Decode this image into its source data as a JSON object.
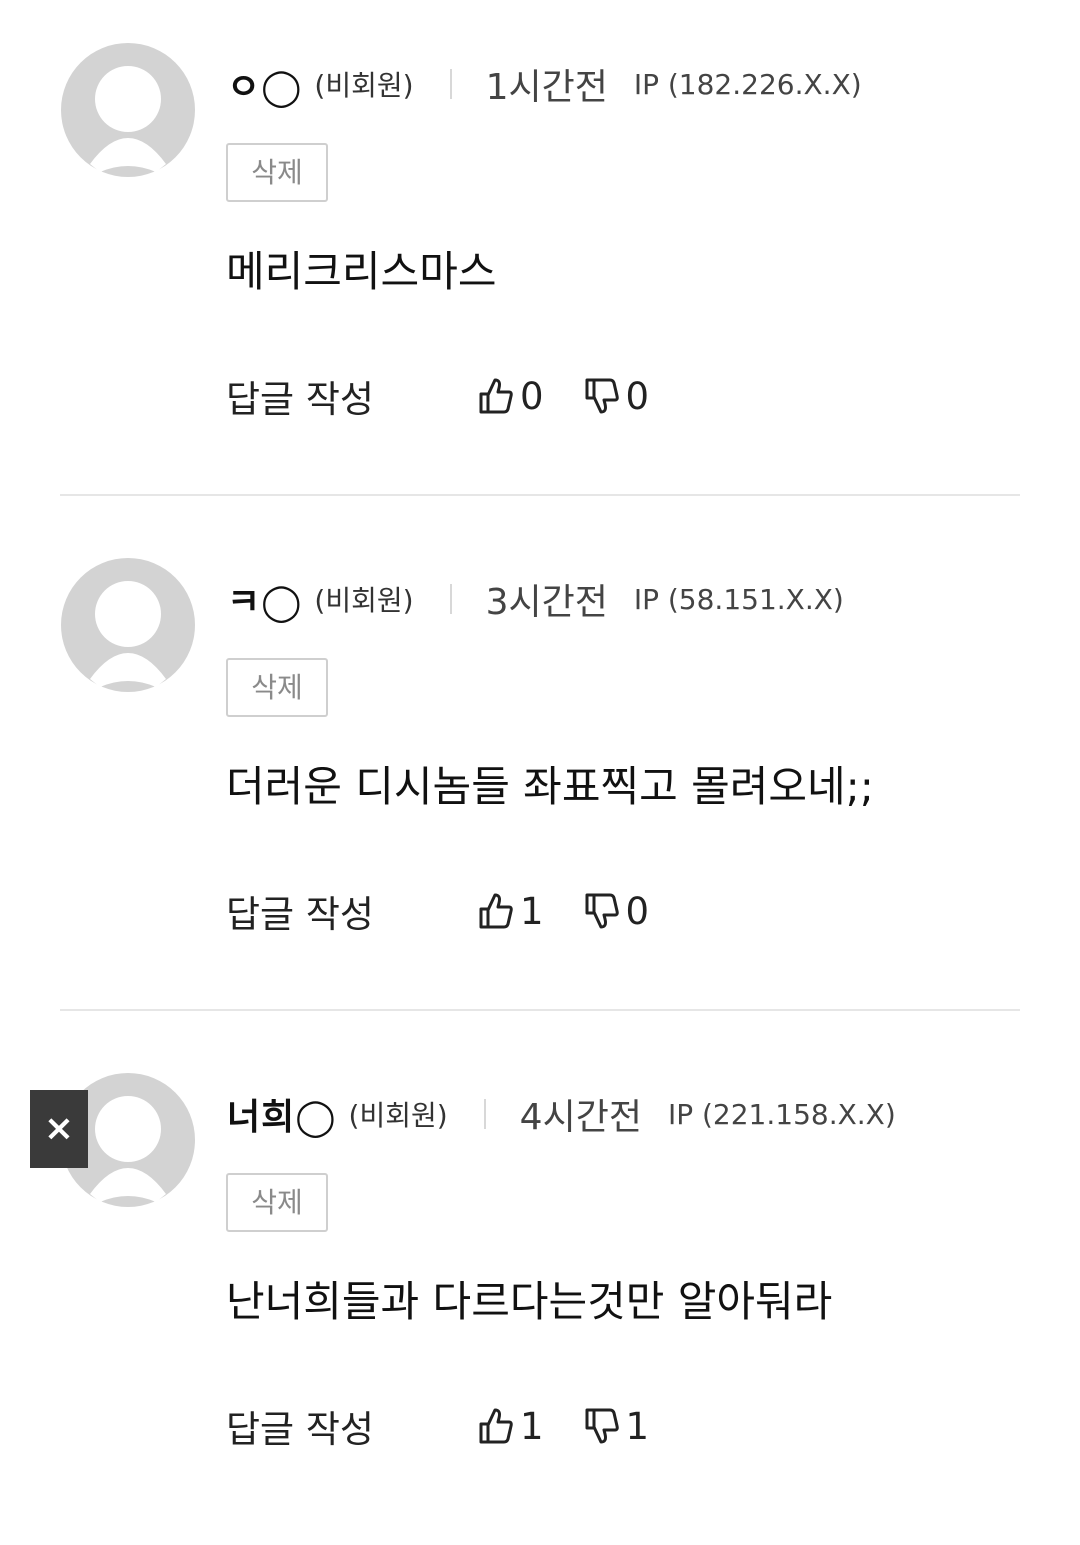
{
  "comments": [
    {
      "author": "ㅇ◯",
      "member_status": "(비회원)",
      "time_ago": "1시간전",
      "ip": "IP (182.226.X.X)",
      "delete_label": "삭제",
      "text": "메리크리스마스",
      "reply_label": "답글 작성",
      "likes": "0",
      "dislikes": "0"
    },
    {
      "author": "ㅋ◯",
      "member_status": "(비회원)",
      "time_ago": "3시간전",
      "ip": "IP (58.151.X.X)",
      "delete_label": "삭제",
      "text": "더러운 디시놈들 좌표찍고 몰려오네;;",
      "reply_label": "답글 작성",
      "likes": "1",
      "dislikes": "0"
    },
    {
      "author": "너희◯",
      "member_status": "(비회원)",
      "time_ago": "4시간전",
      "ip": "IP (221.158.X.X)",
      "delete_label": "삭제",
      "text": "난너희들과 다르다는것만 알아둬라",
      "reply_label": "답글 작성",
      "likes": "1",
      "dislikes": "1"
    }
  ],
  "overlay": {
    "close_label": "×"
  },
  "colors": {
    "avatar_placeholder": "#d3d3d3",
    "divider": "#e6e6e6",
    "delete_border": "#cfcfcf",
    "close_button_bg": "#3a3a3a"
  },
  "icons": {
    "avatar": "default-user-icon",
    "like": "thumbs-up-icon",
    "dislike": "thumbs-down-icon",
    "close": "close-icon"
  }
}
